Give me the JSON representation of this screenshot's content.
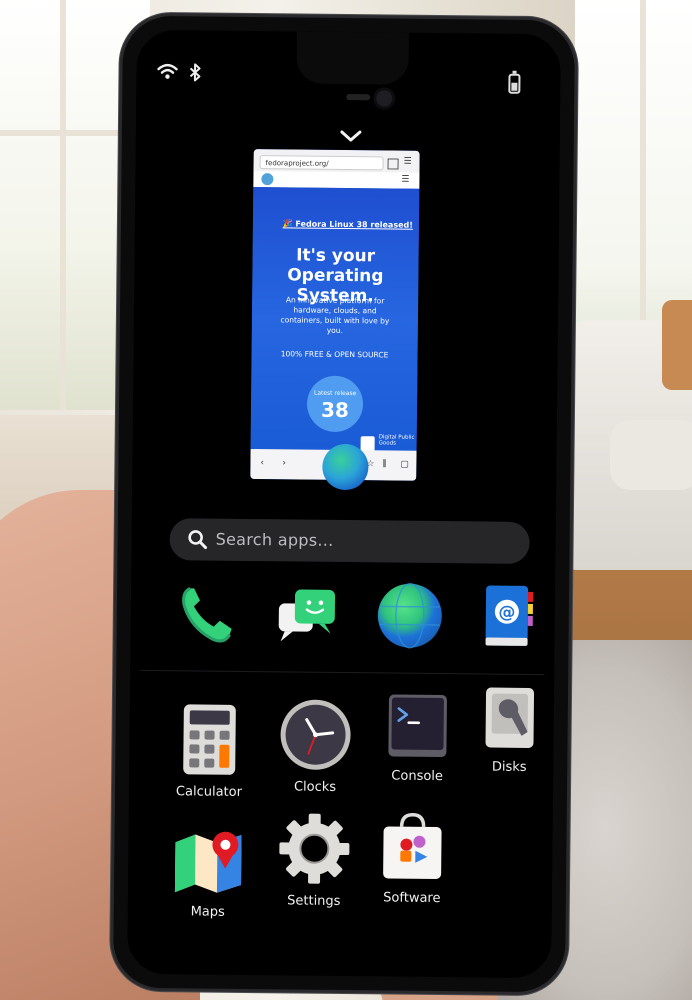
{
  "status_bar": {
    "wifi": "wifi-icon",
    "bluetooth": "bluetooth-icon",
    "battery": "battery-icon"
  },
  "overview": {
    "collapse": "chevron-down-icon"
  },
  "preview": {
    "url": "fedoraproject.org/",
    "banner": "🎉 Fedora Linux 38 released!",
    "title": "It's your Operating System.",
    "description": "An innovative platform for hardware, clouds, and containers, built with love by you.",
    "free_label": "100% FREE & OPEN SOURCE",
    "release_label": "Latest release",
    "release_number": "38",
    "dpg_text": "Digital Public Goods"
  },
  "search": {
    "placeholder": "Search apps..."
  },
  "dock": [
    {
      "name": "phone",
      "icon": "phone-icon"
    },
    {
      "name": "chats",
      "icon": "chat-icon"
    },
    {
      "name": "web",
      "icon": "globe-icon"
    },
    {
      "name": "contacts",
      "icon": "address-book-icon"
    }
  ],
  "apps": [
    {
      "label": "Calculator",
      "icon": "calculator-icon"
    },
    {
      "label": "Clocks",
      "icon": "clock-icon"
    },
    {
      "label": "Console",
      "icon": "terminal-icon"
    },
    {
      "label": "Disks",
      "icon": "disk-icon"
    },
    {
      "label": "Maps",
      "icon": "map-icon"
    },
    {
      "label": "Settings",
      "icon": "gear-icon"
    },
    {
      "label": "Software",
      "icon": "store-icon"
    }
  ],
  "colors": {
    "accent": "#1a56c9",
    "screen_bg": "#000000",
    "search_bg": "#262629"
  }
}
